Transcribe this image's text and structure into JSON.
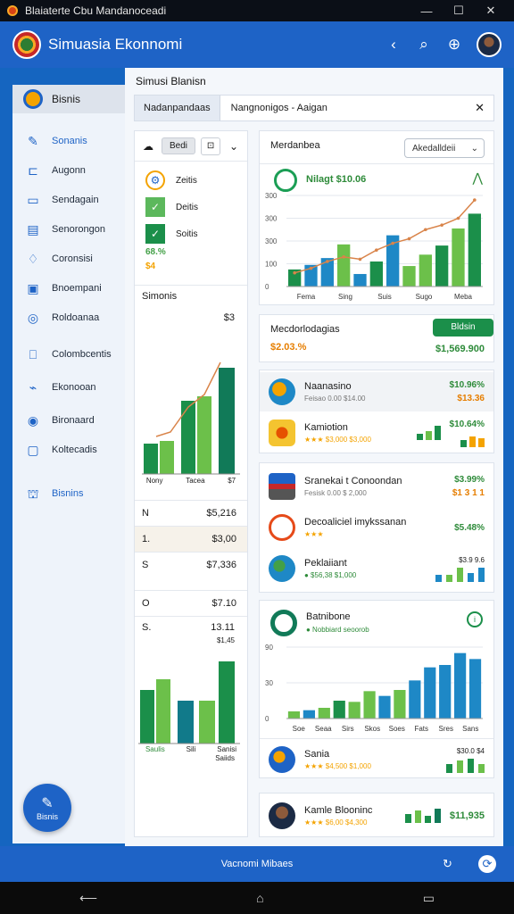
{
  "window": {
    "title": "Blaiaterte  Cbu  Mandanoceadi"
  },
  "header": {
    "app_title": "Simuasia Ekonnomi"
  },
  "sidebar": {
    "active_label": "Bisnis",
    "items": [
      {
        "label": "Sonanis",
        "icon": "pen-icon"
      },
      {
        "label": "Augonn",
        "icon": "folder-icon"
      },
      {
        "label": "Sendagain",
        "icon": "box-icon"
      },
      {
        "label": "Senorongon",
        "icon": "card-icon"
      },
      {
        "label": "Coronsisi",
        "icon": "leaf-icon"
      },
      {
        "label": "Bnoempani",
        "icon": "square-icon"
      },
      {
        "label": "Roldoanaa",
        "icon": "globe-icon"
      },
      {
        "label": "Colombcentis",
        "icon": "document-icon"
      },
      {
        "label": "Ekonooan",
        "icon": "chart-icon"
      },
      {
        "label": "Bironaard",
        "icon": "target-icon"
      },
      {
        "label": "Koltecadis",
        "icon": "grid-icon"
      }
    ],
    "footer_label": "Bisnins",
    "fab_label": "Bisnis"
  },
  "main": {
    "title": "Simusi Blanisn",
    "tabs": [
      {
        "label": "Nadanpandaas"
      },
      {
        "label": "Nangnonigos  -   Aaigan"
      }
    ]
  },
  "left": {
    "toolbar_btn": "Bedi",
    "toolbar_btn2": "⊡",
    "checks": [
      {
        "label": "Zeitis"
      },
      {
        "label": "Deitis"
      },
      {
        "label": "Soitis"
      }
    ],
    "pct1": "68.%",
    "pct2": "$4",
    "sec1_title": "Simonis",
    "sec1_value": "$3",
    "sec1_axis": [
      "Nony",
      "Tacea",
      "$7"
    ],
    "rows": [
      {
        "label": "N",
        "value": "$5,216"
      },
      {
        "label": "1.",
        "value": "$3,00"
      },
      {
        "label": "S",
        "value": "$7,336"
      },
      {
        "label": "O",
        "value": "$7.10"
      }
    ],
    "sec2_title": "S.",
    "sec2_value": "13.11",
    "sec2_sub": "$1,45",
    "sec2_axis": [
      "Saulis",
      "Sili",
      "Sanisi",
      "Saiids"
    ]
  },
  "chart1_card": {
    "title": "Merdanbea",
    "dropdown": "Akedalldeii",
    "legend": "Nilagt  $10.06"
  },
  "summary_card": {
    "title": "Mecdorlodagias",
    "pct": "$2.03.%",
    "button": "Bldsin",
    "value": "$1,569.900"
  },
  "list1": [
    {
      "name": "Naanasino",
      "sub": "Feisao 0.00 $14.00",
      "value1": "$10.96%",
      "value2": "$13.36"
    },
    {
      "name": "Kamiotion",
      "sub": "★★★ $3,000 $3,000",
      "value1": "$10.64%",
      "value2": ""
    }
  ],
  "list2": [
    {
      "name": "Sranekai t Conoondan",
      "sub": "Fesisk 0.00  $ 2,000",
      "value1": "$3.99%",
      "value2": "$1 3 1 1"
    },
    {
      "name": "Decoaliciel imykssanan",
      "sub": "★★★",
      "value1": "$5.48%",
      "value2": ""
    },
    {
      "name": "Peklaiiant",
      "sub": "●  $56,38  $1,000",
      "value1": "$3.9 9.6",
      "value2": ""
    }
  ],
  "chart2_card": {
    "title": "Batnibone",
    "sub": "●  Nobbiard seoorob",
    "bottom_name": "Sania",
    "bottom_sub": "★★★ $4,500  $1,000",
    "bottom_val": "$30.0 $4"
  },
  "person_card": {
    "name": "Kamle Blooninc",
    "sub": "★★★ $6,00 $4,300",
    "value": "$11,935"
  },
  "bottombar": {
    "label": "Vacnomi Mibaes"
  },
  "chart_data": [
    {
      "type": "bar",
      "title": "Merdanbea",
      "categories": [
        "Fema",
        "Sing",
        "Suis",
        "Sugo",
        "Meba"
      ],
      "series": [
        {
          "values": [
            75,
            95,
            125,
            185,
            55,
            110,
            225,
            90,
            140,
            180,
            255,
            320
          ]
        }
      ],
      "line_values": [
        60,
        80,
        110,
        130,
        120,
        160,
        190,
        210,
        250,
        270,
        300,
        380
      ],
      "yticks": [
        "0",
        "100",
        "300",
        "300",
        "300"
      ],
      "ylim": [
        0,
        400
      ]
    },
    {
      "type": "bar",
      "title": "Batnibone",
      "categories": [
        "Soe",
        "Seaa",
        "Sirs",
        "Skos",
        "Soes",
        "Fats",
        "Sres",
        "Sans"
      ],
      "series": [
        {
          "values": [
            12,
            14,
            18,
            30,
            28,
            46,
            38,
            48,
            64,
            86,
            90,
            110,
            100
          ]
        }
      ],
      "yticks": [
        "0",
        "30",
        "90"
      ],
      "ylim": [
        0,
        120
      ]
    }
  ]
}
